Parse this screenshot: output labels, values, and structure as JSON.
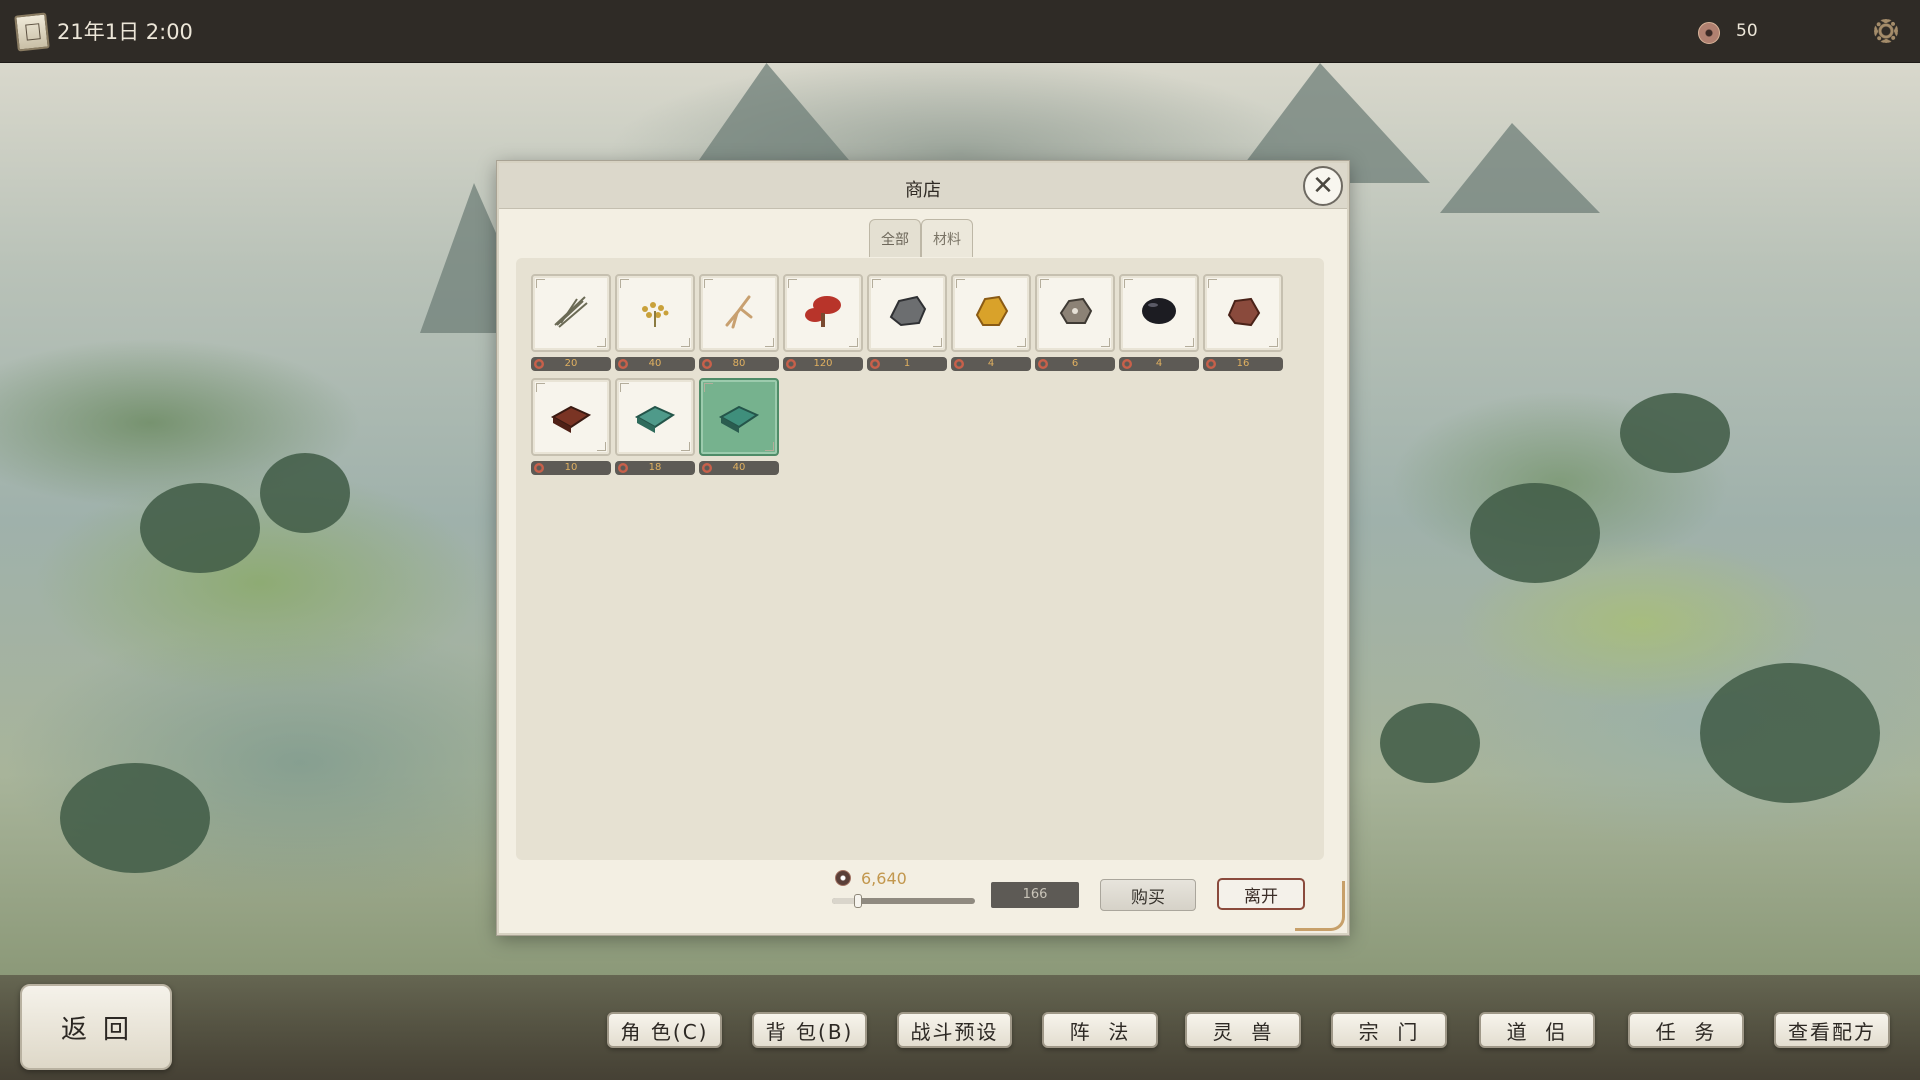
{
  "topbar": {
    "date": "21年1日  2:00",
    "coins": "50",
    "icons": [
      "calendar-icon",
      "coin-icon",
      "settings-gear-icon"
    ]
  },
  "shop": {
    "title": "商店",
    "close_symbol": "✕",
    "tabs": [
      {
        "label": "全部",
        "active": true
      },
      {
        "label": "材料",
        "active": false
      }
    ],
    "items": [
      {
        "icon": "herb-bundle-icon",
        "price": "20",
        "color": "#6b6a55"
      },
      {
        "icon": "golden-grass-icon",
        "price": "40",
        "color": "#c9a13a"
      },
      {
        "icon": "ginseng-root-icon",
        "price": "80",
        "color": "#c8a070"
      },
      {
        "icon": "red-lingzhi-mushroom-icon",
        "price": "120",
        "color": "#b8342a"
      },
      {
        "icon": "grey-iron-ore-icon",
        "price": "1",
        "color": "#6c6e70"
      },
      {
        "icon": "gold-ore-icon",
        "price": "4",
        "color": "#d9a22a"
      },
      {
        "icon": "silver-ore-icon",
        "price": "6",
        "color": "#8c8276"
      },
      {
        "icon": "black-obsidian-icon",
        "price": "4",
        "color": "#1c1c22"
      },
      {
        "icon": "red-copper-ore-icon",
        "price": "16",
        "color": "#8a4a3c"
      },
      {
        "icon": "red-ingot-icon",
        "price": "10",
        "color": "#7a3424"
      },
      {
        "icon": "jade-ingot-icon",
        "price": "18",
        "color": "#4f9a8a"
      },
      {
        "icon": "jade-ingot-selected-icon",
        "price": "40",
        "color": "#3f8f7c",
        "selected": true
      }
    ],
    "money": "6,640",
    "quantity": "166",
    "slider_fraction": 0.18,
    "buy_label": "购买",
    "leave_label": "离开"
  },
  "bottom": {
    "back_label": "返回",
    "nav": [
      "角 色(C)",
      "背 包(B)",
      "战斗预设",
      "阵  法",
      "灵  兽",
      "宗  门",
      "道  侣",
      "任  务",
      "查看配方"
    ]
  }
}
